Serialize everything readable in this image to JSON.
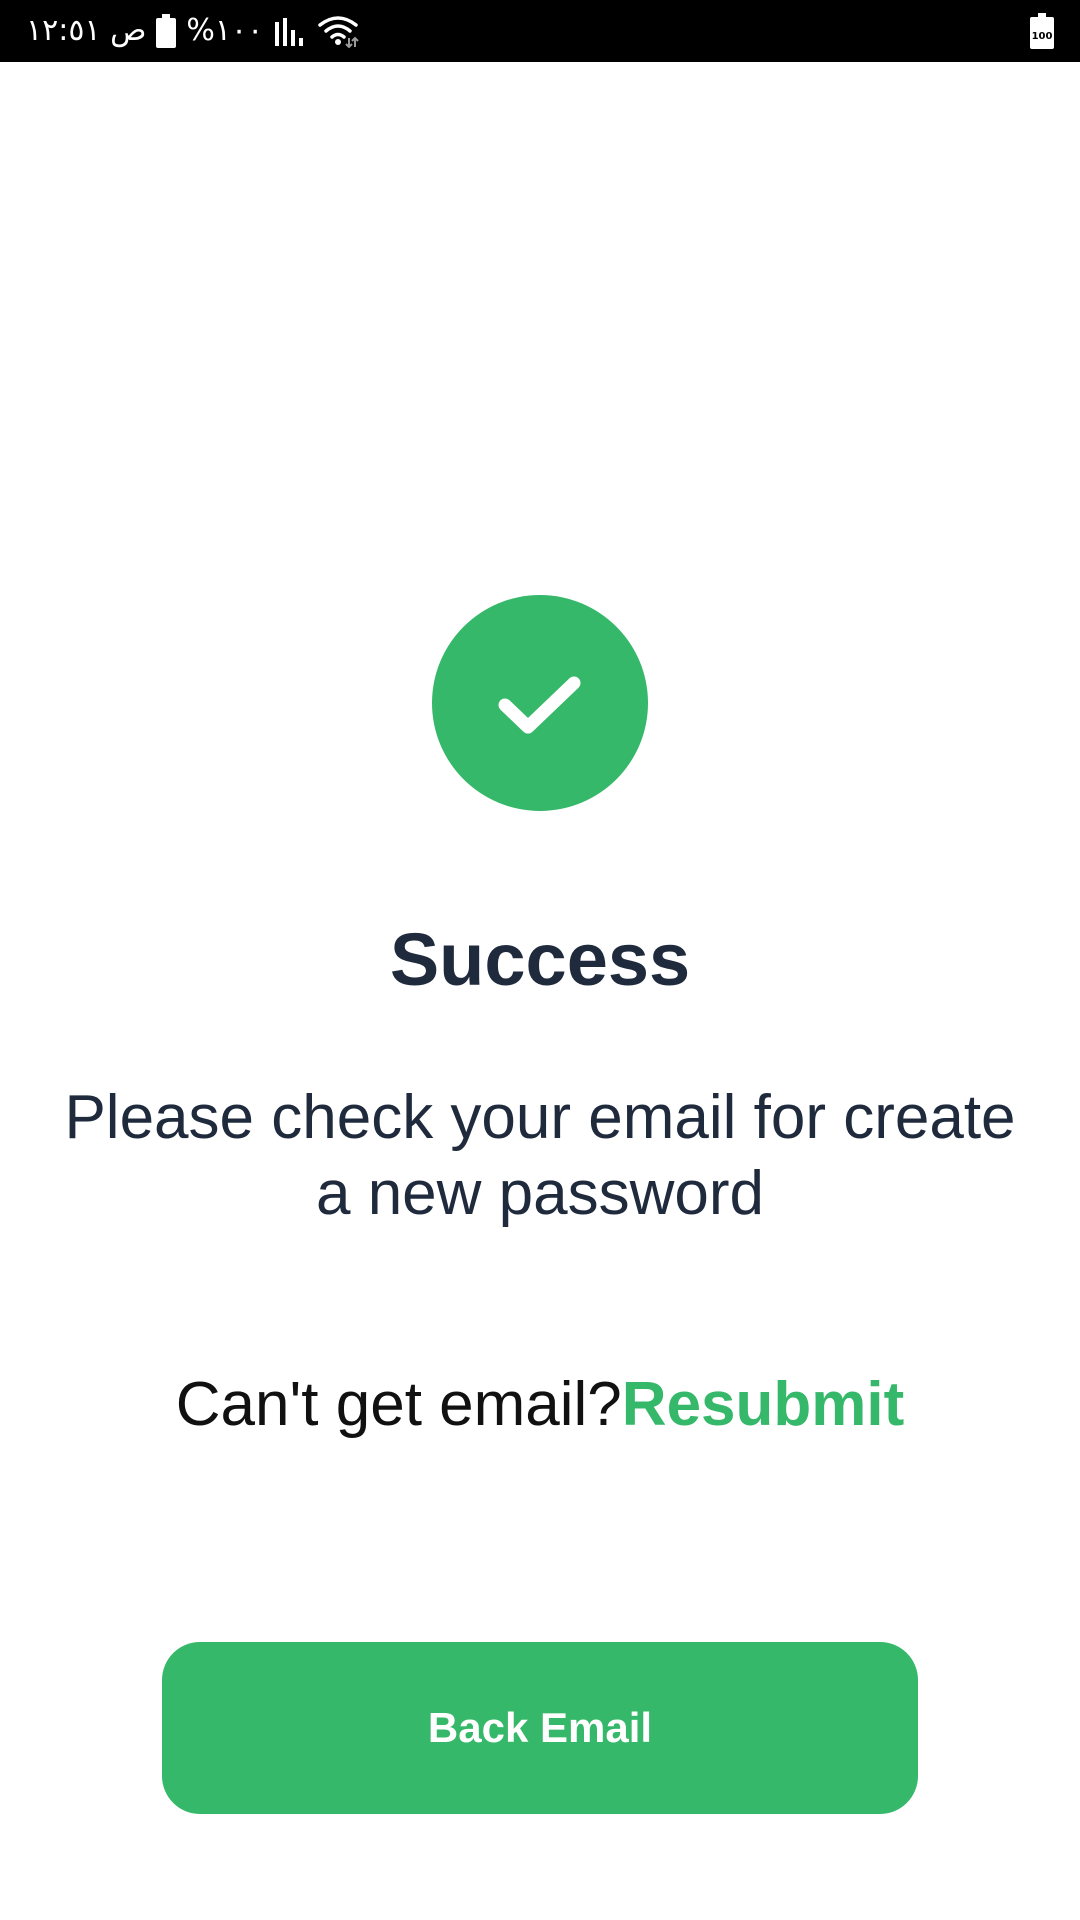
{
  "status_bar": {
    "time": "ص ١٢:٥١",
    "battery_percent": "%١٠٠",
    "right_battery_label": "100",
    "icons": [
      "battery-icon",
      "signal-icon",
      "wifi-icon",
      "battery-icon"
    ]
  },
  "main": {
    "icon": "check-circle-icon",
    "title": "Success",
    "message": "Please check your email for create a new password",
    "resend_prompt": "Can't get email?",
    "resend_link": "Resubmit",
    "back_button_label": "Back Email"
  },
  "colors": {
    "accent": "#35b869",
    "text_dark": "#1f2a3c",
    "status_bar_bg": "#000000",
    "background": "#ffffff"
  }
}
